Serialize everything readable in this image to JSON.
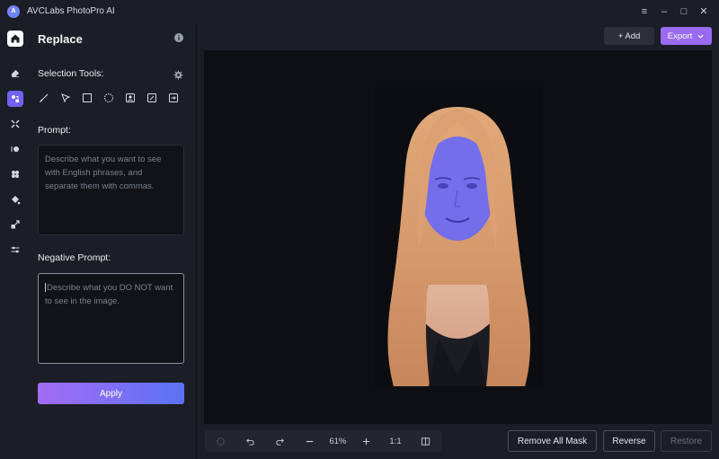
{
  "app": {
    "logo_text": "A",
    "title": "AVCLabs PhotoPro AI"
  },
  "window_controls": {
    "menu": "≡",
    "minimize": "–",
    "maximize": "□",
    "close": "✕"
  },
  "rail": {
    "items": [
      "home",
      "eraser",
      "replace",
      "upscale",
      "enhance",
      "cutout",
      "colorize",
      "resize",
      "adjust"
    ],
    "active": "replace"
  },
  "panel": {
    "title": "Replace",
    "selection_tools_label": "Selection Tools:",
    "tools": [
      "brush",
      "pointer",
      "rectangle",
      "ellipse",
      "person-select",
      "edit",
      "import"
    ],
    "prompt_label": "Prompt:",
    "prompt_placeholder": "Describe what you want to see with English phrases, and separate them with commas.",
    "negative_prompt_label": "Negative Prompt:",
    "negative_prompt_placeholder": "Describe what you DO NOT want to see in the image.",
    "apply_label": "Apply"
  },
  "toolbar": {
    "add_label": "+ Add",
    "export_label": "Export"
  },
  "bottom": {
    "zoom_level": "61%",
    "ratio_label": "1:1",
    "remove_all_mask_label": "Remove All Mask",
    "reverse_label": "Reverse",
    "restore_label": "Restore"
  },
  "colors": {
    "accent": "#6f62f0",
    "export": "#9a6af0",
    "apply_gradient_start": "#a46cf5",
    "apply_gradient_end": "#5a72f3",
    "mask_overlay": "#6e6cf0"
  }
}
